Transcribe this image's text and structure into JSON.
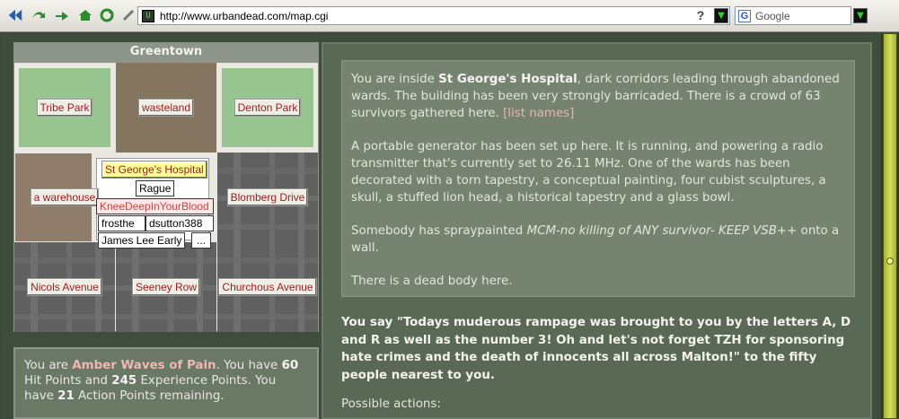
{
  "browser": {
    "url": "http://www.urbandead.com/map.cgi",
    "search_placeholder": "Google",
    "site_icon_glyph": "U",
    "help_glyph": "?"
  },
  "map": {
    "suburb": "Greentown",
    "row1": [
      "Tribe Park",
      "wasteland",
      "Denton Park"
    ],
    "row2": [
      "a warehouse",
      "St George's Hospital",
      "Blomberg Drive"
    ],
    "row3": [
      "Nicols Avenue",
      "Seeney Row",
      "Churchous Avenue"
    ],
    "survivors": {
      "s1": "Rague",
      "s2": "KneeDeepInYourBlood",
      "s3": "frosthe",
      "s4": "dsutton388",
      "s5": "James Lee Early",
      "more": "..."
    }
  },
  "status": {
    "prefix": "You are",
    "name": "Amber Waves of Pain",
    "mid1": ". You have",
    "hp": "60",
    "mid2": "Hit Points and",
    "xp": "245",
    "mid3": "Experience Points. You have",
    "ap": "21",
    "suffix": "Action Points remaining."
  },
  "description": {
    "p1_pre": "You are inside",
    "p1_place": "St George's Hospital",
    "p1_post": ", dark corridors leading through abandoned wards. The building has been very strongly barricaded. There is a crowd of 63 survivors gathered here.",
    "list_names": "[list names]",
    "p2": "A portable generator has been set up here. It is running, and powering a radio transmitter that's currently set to 26.11 MHz. One of the wards has been decorated with a torn tapestry, a conceptual painting, four cubist sculptures, a skull, a stuffed lion head, a historical tapestry and a glass bowl.",
    "p3_pre": "Somebody has spraypainted",
    "p3_graffiti": "MCM-no killing of ANY survivor- KEEP VSB++",
    "p3_post": "onto a wall.",
    "p4": "There is a dead body here."
  },
  "speech": "You say \"Todays muderous rampage was brought to you by the letters A, D and R as well as the number 3! Oh and let's not forget TZH for sponsoring hate crimes and the death of innocents all across Malton!\" to the fifty people nearest to you.",
  "actions_label": "Possible actions:",
  "icons": [
    "back-icon",
    "forward-icon",
    "reload-icon",
    "home-icon",
    "stop-icon",
    "download-icon",
    "search-go-icon"
  ]
}
